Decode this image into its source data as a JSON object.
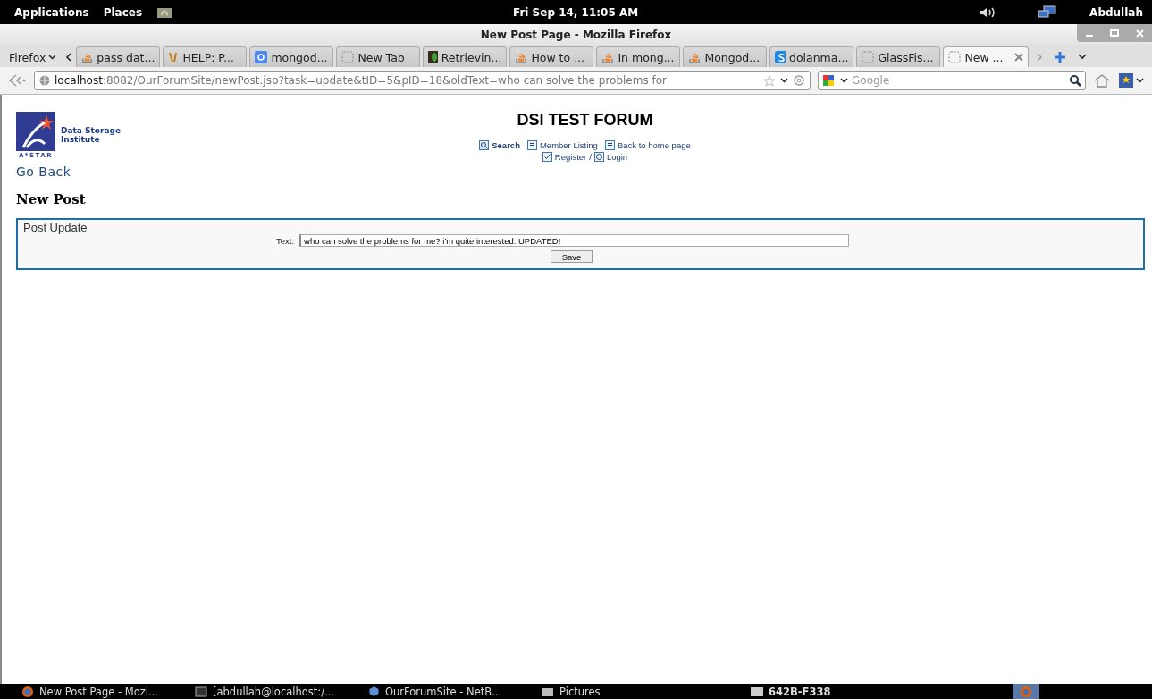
{
  "top_panel": {
    "menus": [
      "Applications",
      "Places"
    ],
    "clock": "Fri Sep 14, 11:05 AM",
    "user": "Abdullah"
  },
  "window": {
    "title": "New Post Page - Mozilla Firefox"
  },
  "firefox_menu": "Firefox",
  "tabs": [
    {
      "label": "pass dat...",
      "kind": "stack",
      "selected": false
    },
    {
      "label": "HELP: P...",
      "kind": "v",
      "selected": false
    },
    {
      "label": "mongod...",
      "kind": "google",
      "selected": false
    },
    {
      "label": "New Tab",
      "kind": "blank",
      "selected": false
    },
    {
      "label": "Retrievin...",
      "kind": "leaf",
      "selected": false
    },
    {
      "label": "How to ...",
      "kind": "stack",
      "selected": false
    },
    {
      "label": "In mong...",
      "kind": "stack",
      "selected": false
    },
    {
      "label": "Mongod...",
      "kind": "stack",
      "selected": false
    },
    {
      "label": "dolanma...",
      "kind": "skype",
      "selected": false
    },
    {
      "label": "GlassFis...",
      "kind": "blank",
      "selected": false
    },
    {
      "label": "New ...",
      "kind": "blank",
      "selected": true
    }
  ],
  "address": {
    "host": "localhost",
    "rest": ":8082/OurForumSite/newPost.jsp?task=update&tID=5&pID=18&oldText=who can solve the problems for"
  },
  "search": {
    "placeholder": "Google"
  },
  "page": {
    "logo_text": [
      "Data Storage",
      "Institute"
    ],
    "logo_caption": "A*STAR",
    "go_back": "Go Back",
    "heading": "New Post",
    "forum_title": "DSI TEST FORUM",
    "nav": [
      {
        "label": "Search",
        "kind": "search",
        "bold": true
      },
      {
        "label": "Member Listing",
        "kind": "list",
        "bold": false
      },
      {
        "label": "Back to home page",
        "kind": "list",
        "bold": false
      }
    ],
    "register": "Register",
    "separator": "/",
    "login": "Login",
    "form": {
      "legend": "Post Update",
      "label": "Text:",
      "value": "who can solve the problems for me? i'm quite interested. UPDATED!",
      "button": "Save"
    }
  },
  "taskbar": [
    {
      "label": "New Post Page - Mozi...",
      "kind": "firefox"
    },
    {
      "label": "[abdullah@localhost:/...",
      "kind": "terminal"
    },
    {
      "label": "OurForumSite - NetB...",
      "kind": "cube"
    },
    {
      "label": "Pictures",
      "kind": "folder"
    }
  ],
  "keyboard": "642B-F338"
}
